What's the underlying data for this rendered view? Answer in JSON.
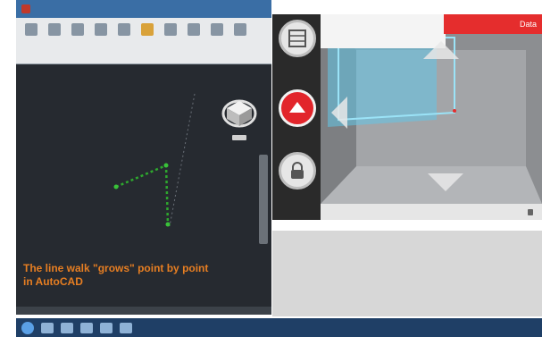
{
  "autocad": {
    "title": "",
    "ribbon_tools": [
      "",
      "",
      "",
      "",
      "",
      "",
      "",
      "",
      "",
      ""
    ],
    "caption": "The line walk \"grows\" point by point in AutoCAD"
  },
  "phone_app": {
    "side_buttons": [
      "grid-icon",
      "up-arrow-icon",
      "lock-icon"
    ],
    "red_bar_label": "Data",
    "toolbar_labels": [
      "",
      ""
    ]
  },
  "notes": {
    "lines": [
      "",
      "",
      "",
      "",
      "",
      ""
    ]
  },
  "taskbar": {
    "clock": ""
  },
  "colors": {
    "accent_red": "#e2252b",
    "caption_orange": "#e67e22",
    "line_green": "#2ea82e"
  }
}
